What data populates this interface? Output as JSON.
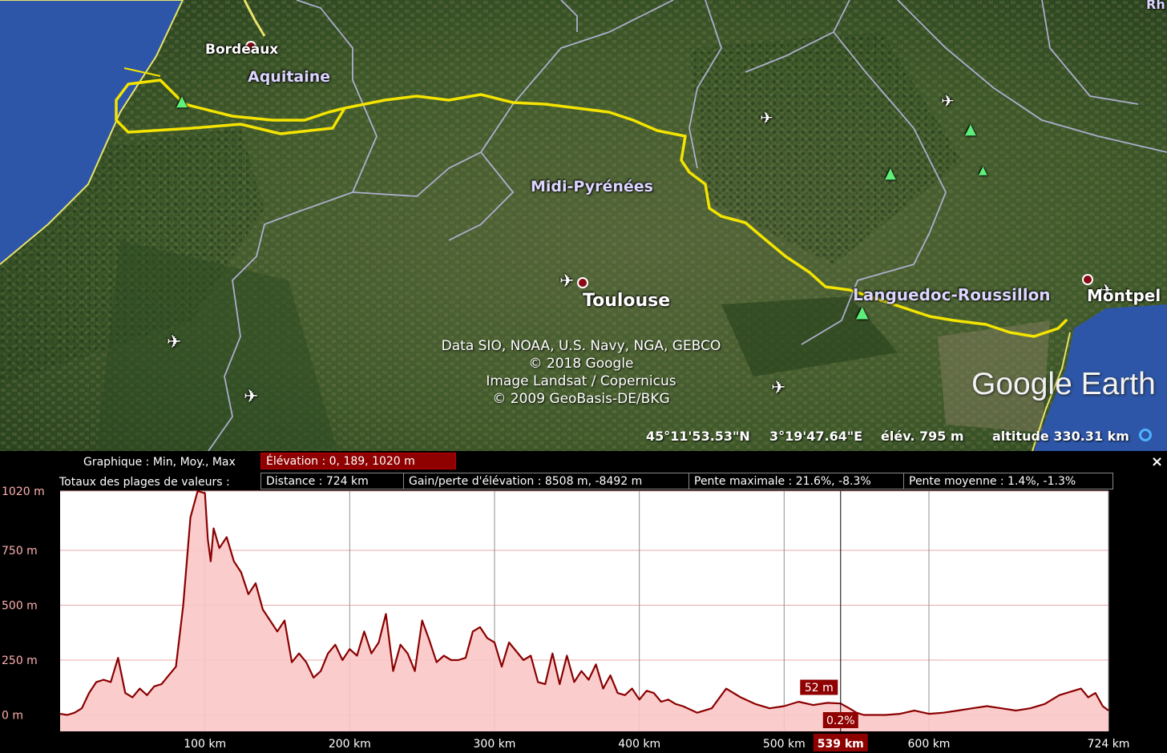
{
  "map": {
    "labels": {
      "bordeaux": "Bordeaux",
      "aquitaine": "Aquitaine",
      "midi": "Midi-Pyrénées",
      "toulouse": "Toulouse",
      "languedoc": "Languedoc-Roussillon",
      "montpel": "Montpel",
      "corner": "Rh"
    },
    "credits": [
      "Data SIO, NOAA, U.S. Navy, NGA, GEBCO",
      "© 2018 Google",
      "Image Landsat / Copernicus",
      "© 2009 GeoBasis-DE/BKG"
    ],
    "brand": "Google Earth",
    "status": {
      "lat": "45°11'53.53\"N",
      "lon": "3°19'47.64\"E",
      "elev": "élév.  795 m",
      "altitude": "altitude 330.31 km"
    },
    "colors": {
      "track": "#f4e400",
      "land": "#3d5a2a",
      "sea": "#2d56a8",
      "borders": "#b8b8e0"
    },
    "icons": [
      "airport-icon",
      "park-tree-icon",
      "city-dot-icon"
    ]
  },
  "panel": {
    "graph_label": "Graphique : Min, Moy., Max",
    "elevation_label": "Élévation : 0, 189, 1020 m",
    "totals_label": "Totaux des plages de valeurs :",
    "distance": "Distance : 724 km",
    "gain": "Gain/perte d'élévation : 8508 m, -8492 m",
    "max_slope": "Pente maximale : 21.6%, -8.3%",
    "avg_slope": "Pente moyenne : 1.4%, -1.3%",
    "close": "×"
  },
  "chart_data": {
    "type": "area",
    "xlabel": "",
    "ylabel": "",
    "xlim": [
      0,
      724
    ],
    "ylim": [
      -75,
      1020
    ],
    "x_ticks": [
      {
        "value": 100,
        "label": "100 km"
      },
      {
        "value": 200,
        "label": "200 km"
      },
      {
        "value": 300,
        "label": "300 km"
      },
      {
        "value": 400,
        "label": "400 km"
      },
      {
        "value": 500,
        "label": "500 km"
      },
      {
        "value": 600,
        "label": "600 km"
      },
      {
        "value": 724,
        "label": "724 km"
      }
    ],
    "y_ticks": [
      {
        "value": 0,
        "label": "0 m"
      },
      {
        "value": 250,
        "label": "250 m"
      },
      {
        "value": 500,
        "label": "500 m"
      },
      {
        "value": 750,
        "label": "750 m"
      },
      {
        "value": 1020,
        "label": "1020 m"
      }
    ],
    "cursor": {
      "x": 539,
      "x_label": "539 km",
      "y_label": "52 m",
      "slope_label": "0.2%"
    },
    "x": [
      0,
      5,
      10,
      15,
      20,
      25,
      30,
      35,
      40,
      45,
      50,
      55,
      60,
      65,
      70,
      75,
      80,
      85,
      90,
      95,
      100,
      102,
      104,
      106,
      110,
      115,
      120,
      125,
      130,
      135,
      140,
      145,
      150,
      155,
      160,
      165,
      170,
      175,
      180,
      185,
      190,
      195,
      200,
      205,
      210,
      215,
      220,
      225,
      230,
      235,
      240,
      245,
      250,
      255,
      260,
      265,
      270,
      275,
      280,
      285,
      290,
      295,
      300,
      305,
      310,
      315,
      320,
      325,
      330,
      335,
      340,
      345,
      350,
      355,
      360,
      365,
      370,
      375,
      380,
      385,
      390,
      395,
      400,
      405,
      410,
      415,
      420,
      425,
      430,
      440,
      450,
      460,
      470,
      480,
      490,
      500,
      510,
      520,
      530,
      539,
      545,
      550,
      555,
      560,
      570,
      580,
      590,
      600,
      610,
      620,
      630,
      640,
      650,
      660,
      670,
      680,
      690,
      700,
      705,
      710,
      715,
      720,
      724
    ],
    "y": [
      5,
      0,
      10,
      30,
      100,
      150,
      160,
      150,
      260,
      100,
      80,
      120,
      90,
      130,
      140,
      180,
      220,
      500,
      900,
      1020,
      1010,
      800,
      700,
      850,
      760,
      810,
      700,
      650,
      550,
      600,
      480,
      430,
      380,
      430,
      240,
      280,
      240,
      170,
      200,
      280,
      320,
      250,
      300,
      270,
      380,
      280,
      330,
      460,
      200,
      320,
      280,
      200,
      430,
      340,
      240,
      270,
      250,
      250,
      260,
      380,
      400,
      350,
      330,
      220,
      330,
      290,
      250,
      270,
      150,
      140,
      280,
      140,
      270,
      150,
      200,
      160,
      230,
      120,
      180,
      100,
      90,
      120,
      70,
      110,
      100,
      60,
      70,
      50,
      40,
      10,
      30,
      120,
      80,
      50,
      30,
      40,
      60,
      45,
      55,
      52,
      30,
      10,
      0,
      0,
      0,
      5,
      20,
      5,
      10,
      20,
      30,
      40,
      30,
      20,
      30,
      50,
      90,
      110,
      120,
      80,
      100,
      40,
      20
    ]
  }
}
